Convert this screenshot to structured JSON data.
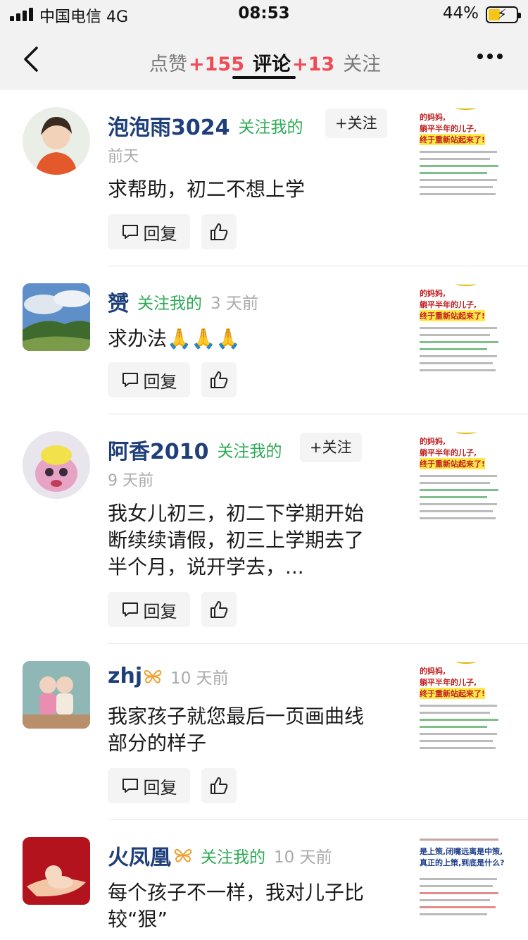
{
  "status_bar": {
    "carrier": "中国电信  4G",
    "time": "08:53",
    "battery": "44%",
    "battery_level": 0.44
  },
  "nav": {
    "tabs": [
      {
        "label": "点赞",
        "count": "+155",
        "active": false
      },
      {
        "label": "评论",
        "count": "+13",
        "active": true
      },
      {
        "label": "关注",
        "count": "",
        "active": false
      }
    ]
  },
  "comments": [
    {
      "name": "泡泡雨3024",
      "follow_me": "关注我的",
      "time": "前天",
      "follow_button": "+关注",
      "text": "求帮助，初二不想上学",
      "reply": "回复",
      "thumb_lines": [
        "的妈妈,",
        "躺平半年的儿子,",
        "终于重新站起来了!"
      ]
    },
    {
      "name": "赟",
      "follow_me": "关注我的",
      "time": "3 天前",
      "text": "求办法🙏🙏🙏",
      "reply": "回复",
      "thumb_lines": [
        "的妈妈,",
        "躺平半年的儿子,",
        "终于重新站起来了!"
      ]
    },
    {
      "name": "阿香2010",
      "follow_me": "关注我的",
      "time": "9 天前",
      "follow_button": "+关注",
      "text": "我女儿初三，初二下学期开始断续续请假，初三上学期去了半个月，说开学去，...",
      "reply": "回复",
      "thumb_lines": [
        "的妈妈,",
        "躺平半年的儿子,",
        "终于重新站起来了!"
      ]
    },
    {
      "name": "zhj",
      "time": "10 天前",
      "text": "我家孩子就您最后一页画曲线部分的样子",
      "reply": "回复",
      "thumb_lines": [
        "的妈妈,",
        "躺平半年的儿子,",
        "终于重新站起来了!"
      ]
    },
    {
      "name": "火凤凰",
      "follow_me": "关注我的",
      "time": "10 天前",
      "text": "每个孩子不一样，我对儿子比较“狠”",
      "thumb_lines": [
        "是上策,闭嘴远离是中策,",
        "真正的上策,到底是什么?"
      ]
    }
  ]
}
